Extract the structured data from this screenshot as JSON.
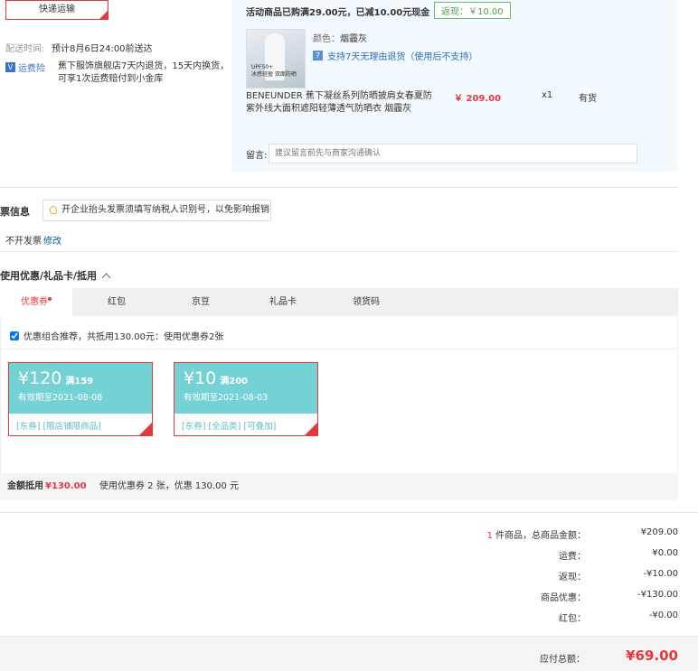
{
  "shipping": {
    "method_button": "快递运输",
    "delivery_label": "配送时间:",
    "delivery_value": "预计8月6日24:00前送达",
    "insurance_badge": "运费险",
    "insurance_text_1": "蕉下服饰旗舰店7天内退货，15天内换货，",
    "insurance_text_2": "可享1次运费赔付到小金库"
  },
  "promo": {
    "text": "活动商品已购满29.00元，已减10.00元现金",
    "rebate_badge": "返现：￥10.00"
  },
  "product": {
    "color_label": "颜色：",
    "color_value": "烟霾灰",
    "return_text": "支持7天无理由退货（使用后不支持）",
    "title_1": "BENEUNDER 蕉下凝丝系列防晒披肩女春夏防",
    "title_2": "紫外线大面积遮阳轻薄透气防晒衣 烟霾灰",
    "price": "￥ 209.00",
    "qty": "x1",
    "stock": "有货",
    "thumb_text_1": "UPF50+",
    "thumb_text_2": "冰感轻盈 双面防晒"
  },
  "note": {
    "label": "留言:",
    "placeholder": "建议留言前先与商家沟通确认"
  },
  "invoice": {
    "title": "票信息",
    "tip": "开企业抬头发票须填写纳税人识别号，以免影响报销",
    "status": "不开发票",
    "edit": "修改"
  },
  "discount": {
    "title": "使用优惠/礼品卡/抵用",
    "tabs": [
      "优惠券",
      "红包",
      "京豆",
      "礼品卡",
      "领货码"
    ],
    "combo_label": "优惠组合推荐，共抵用130.00元：使用优惠券2张",
    "coupons": [
      {
        "amount": "¥120",
        "condition": "满159",
        "expiry": "有效期至2021-08-08",
        "tags": [
          "[东券]",
          "[限店铺限商品]"
        ]
      },
      {
        "amount": "¥10",
        "condition": "满200",
        "expiry": "有效期至2021-08-03",
        "tags": [
          "[东券]",
          "[全品类]",
          "[可叠加]"
        ]
      }
    ],
    "summary_label": "金额抵用",
    "summary_amount": "¥130.00",
    "summary_detail": "使用优惠券 2 张，优惠 130.00 元"
  },
  "totals": {
    "count": "1",
    "count_label": " 件商品，总商品金额：",
    "goods_amount": "¥209.00",
    "freight_label": "运费：",
    "freight": "¥0.00",
    "rebate_label": "返现：",
    "rebate": "-¥10.00",
    "coupon_label": "商品优惠：",
    "coupon": "-¥130.00",
    "redpack_label": "红包：",
    "redpack": "-¥0.00",
    "payable_label": "应付总额：",
    "payable": "¥69.00"
  },
  "colors": {
    "accent": "#e4393c",
    "coupon": "#74d2d4",
    "panel": "#f3faff"
  }
}
